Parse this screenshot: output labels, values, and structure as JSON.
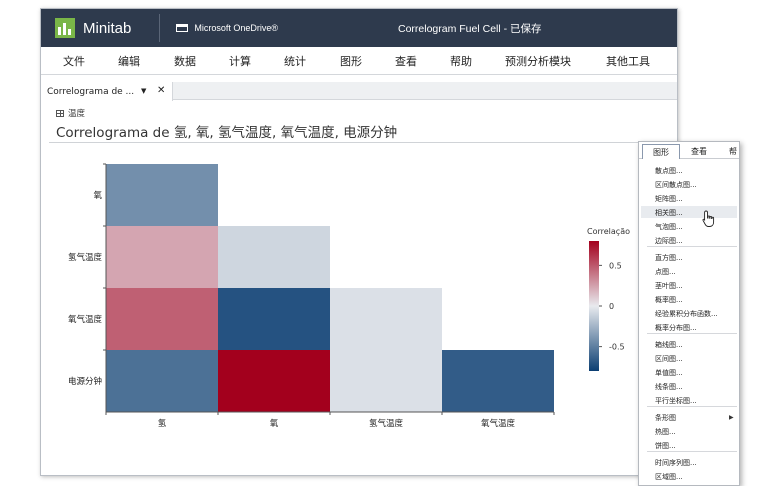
{
  "app": {
    "name": "Minitab",
    "cloud": "Microsoft OneDrive®",
    "document_title": "Correlogram Fuel Cell  -  已保存"
  },
  "menu": [
    "文件",
    "编辑",
    "数据",
    "计算",
    "统计",
    "图形",
    "查看",
    "帮助",
    "预测分析模块",
    "其他工具"
  ],
  "tab": {
    "label": "Correlograma de ...",
    "caret": "▼",
    "close": "✕"
  },
  "breadcrumb": "温度",
  "chart_title": "Correlograma de 氢, 氧, 氢气温度, 氧气温度, 电源分钟",
  "colors": {
    "titlebar": "#2e3a4d",
    "logo": "#7ab648",
    "strong_negative": "#0b3e72",
    "strong_positive": "#a3001d"
  },
  "chart_data": {
    "type": "heatmap",
    "title": "",
    "row_labels": [
      "氧",
      "氢气温度",
      "氧气温度",
      "电源分钟"
    ],
    "col_labels": [
      "氢",
      "氧",
      "氢气温度",
      "氧气温度"
    ],
    "values": [
      [
        -0.45,
        null,
        null,
        null
      ],
      [
        0.25,
        -0.1,
        null,
        null
      ],
      [
        0.5,
        -0.75,
        -0.05,
        null
      ],
      [
        -0.6,
        0.85,
        -0.05,
        -0.7
      ]
    ],
    "legend": {
      "title": "Correlação",
      "ticks": [
        0.5,
        0,
        -0.5
      ],
      "tick_labels": [
        "0.5",
        "0",
        "-0.5"
      ],
      "range": [
        -0.8,
        0.8
      ]
    }
  },
  "graph_menu": {
    "tabs": [
      "图形",
      "查看",
      "帮"
    ],
    "groups": [
      [
        "散点图...",
        "区间散点图...",
        "矩阵图...",
        "相关图...",
        "气泡图...",
        "边际图..."
      ],
      [
        "直方图...",
        "点图...",
        "茎叶图...",
        "概率图...",
        "经验累积分布函数...",
        "概率分布图..."
      ],
      [
        "箱线图...",
        "区间图...",
        "单值图...",
        "线条图...",
        "平行坐标图..."
      ],
      [
        "条形图",
        "热图...",
        "饼图..."
      ],
      [
        "时间序列图...",
        "区域图..."
      ]
    ],
    "hovered": "相关图...",
    "submenu_item": "条形图"
  }
}
